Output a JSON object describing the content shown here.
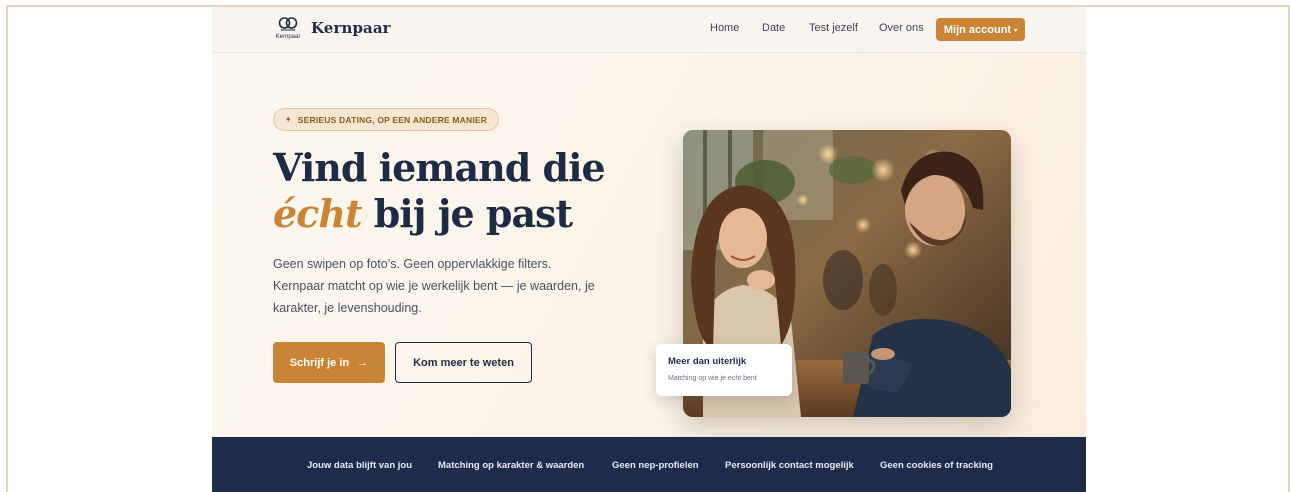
{
  "nav": {
    "logo_small": "Kernpaar",
    "brand": "Kernpaar",
    "links": [
      "Home",
      "Date",
      "Test jezelf",
      "Over ons"
    ],
    "account_label": "Mijn account",
    "account_caret": "▾"
  },
  "hero": {
    "pill_icon": "✦",
    "pill": "SERIEUS DATING, OP EEN ANDERE MANIER",
    "title_line1": "Vind iemand die",
    "title_accent": "écht",
    "title_rest": " bij je past",
    "lead": "Geen swipen op foto’s. Geen oppervlakkige filters. Kernpaar matcht op wie je werkelijk bent — je waarden, je karakter, je levenshouding.",
    "cta_primary": "Schrijf je in",
    "cta_arrow": "→",
    "cta_secondary": "Kom meer te weten"
  },
  "card": {
    "title": "Meer dan uiterlijk",
    "subtitle": "Matching op wie je echt bent"
  },
  "trust": {
    "items": [
      "Jouw data blijft van jou",
      "Matching op karakter & waarden",
      "Geen nep-profielen",
      "Persoonlijk contact mogelijk",
      "Geen cookies of tracking"
    ]
  },
  "colors": {
    "navy": "#1e2b45",
    "accent": "#c98535",
    "trust_bar": "#1e2b4a"
  },
  "icons": {
    "logo": "two-rings-logo-icon",
    "pill": "sparkle-icon",
    "cta": "arrow-right-icon",
    "account": "caret-down-icon"
  }
}
